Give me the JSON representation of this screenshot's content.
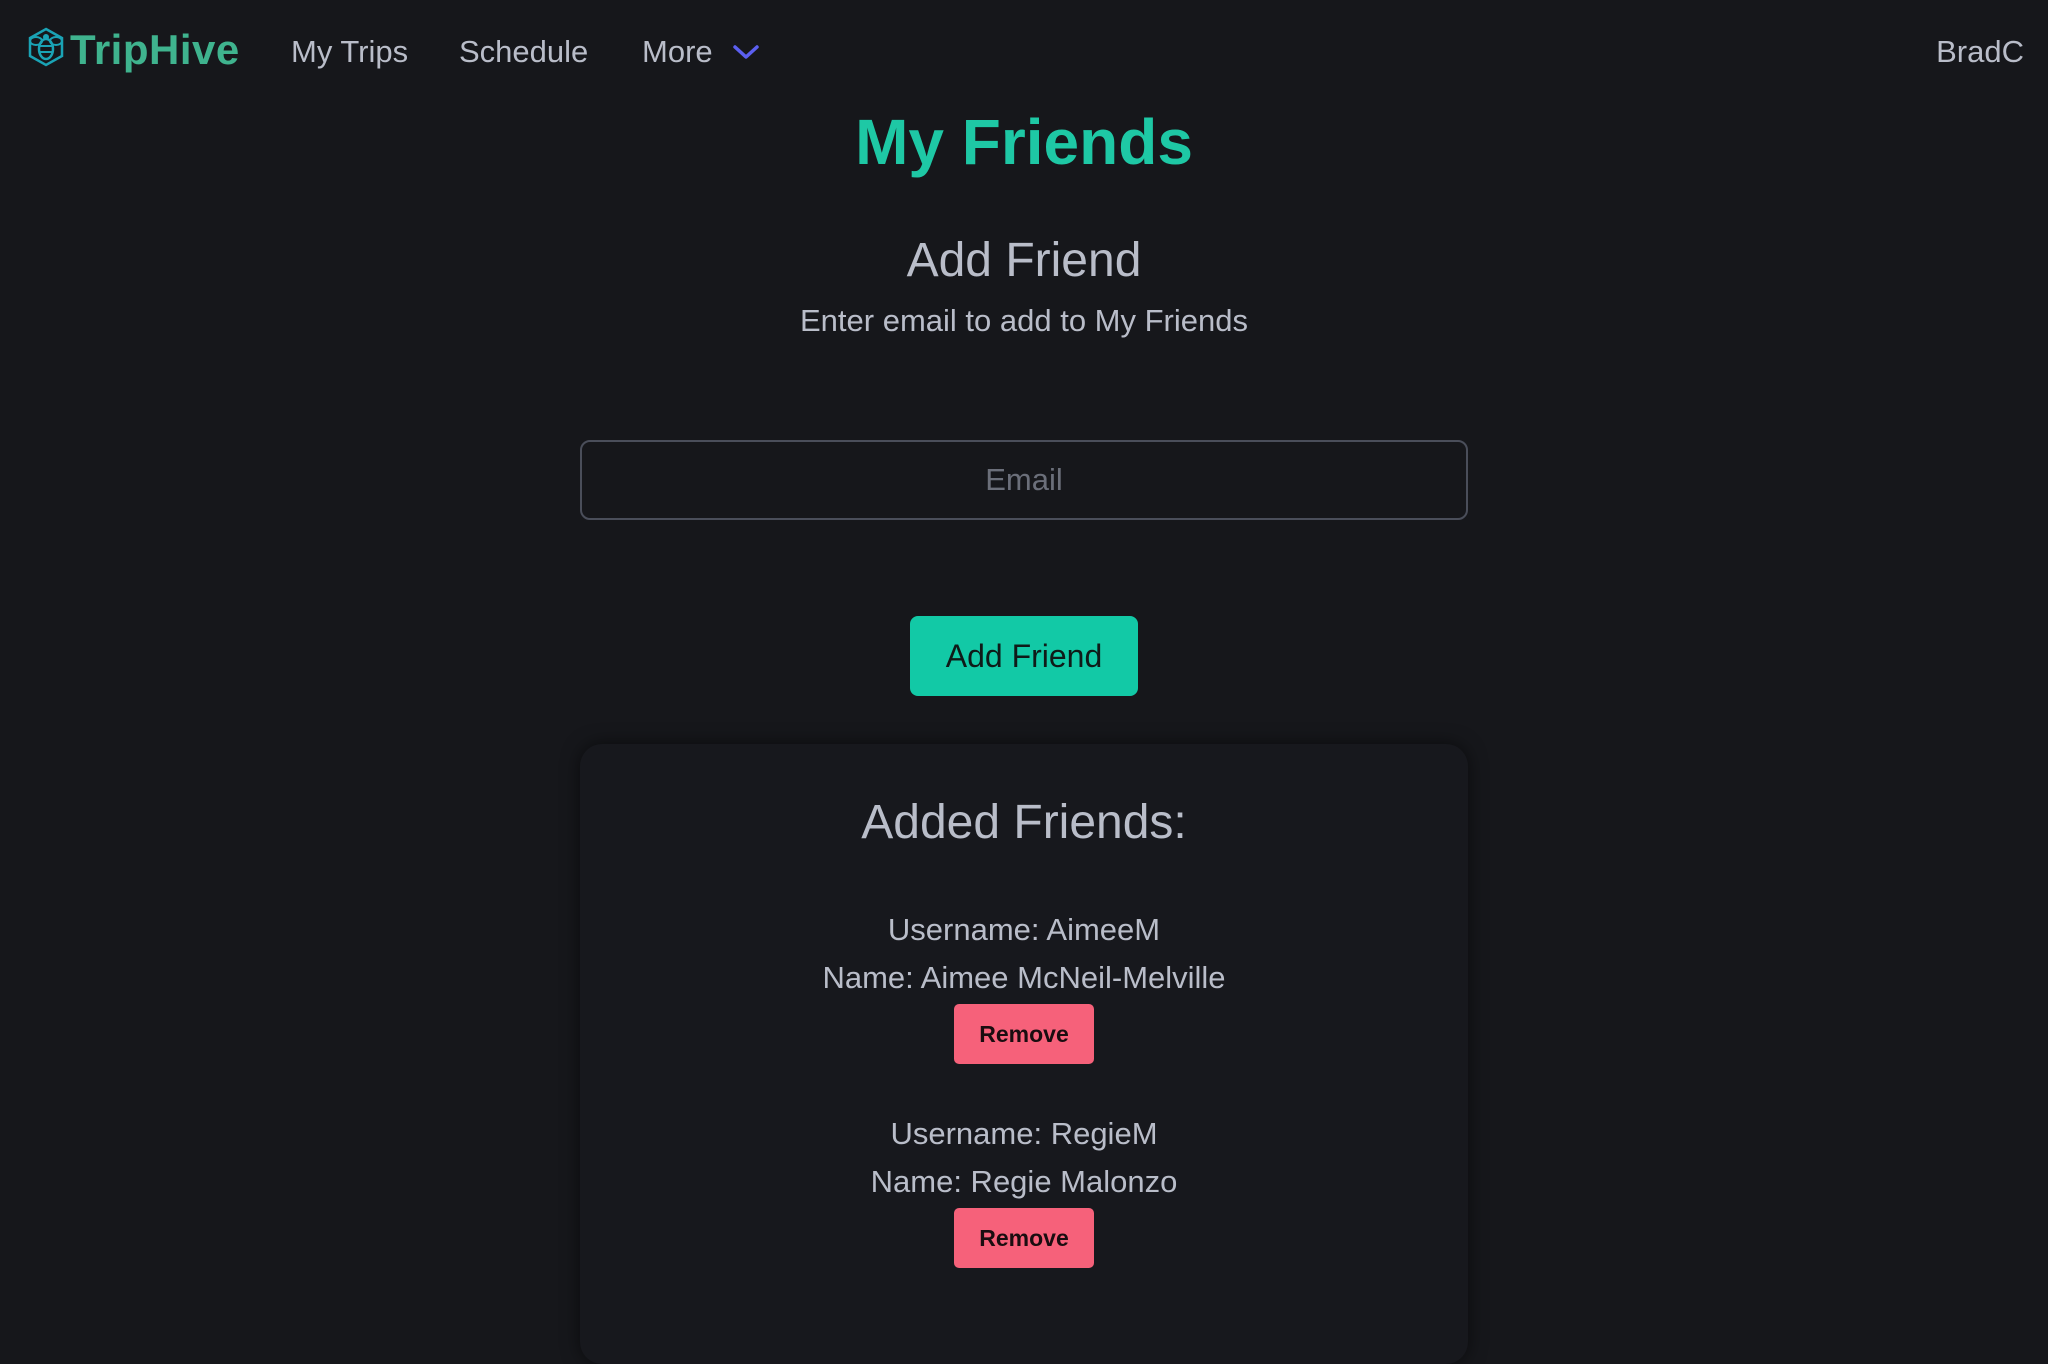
{
  "brand": {
    "name": "TripHive",
    "color": "#3fb38e"
  },
  "nav": {
    "my_trips": "My Trips",
    "schedule": "Schedule",
    "more": "More",
    "user": "BradC"
  },
  "main": {
    "title": "My Friends",
    "add_section_title": "Add Friend",
    "add_section_subtitle": "Enter email to add to My Friends",
    "email_placeholder": "Email",
    "add_button": "Add Friend",
    "accent_color": "#12c9a6"
  },
  "friends": {
    "title": "Added Friends:",
    "items": [
      {
        "username": "Username: AimeeM",
        "name": "Name: Aimee McNeil-Melville",
        "remove_label": "Remove"
      },
      {
        "username": "Username: RegieM",
        "name": "Name: Regie Malonzo",
        "remove_label": "Remove"
      }
    ],
    "remove_color": "#f6617a"
  }
}
